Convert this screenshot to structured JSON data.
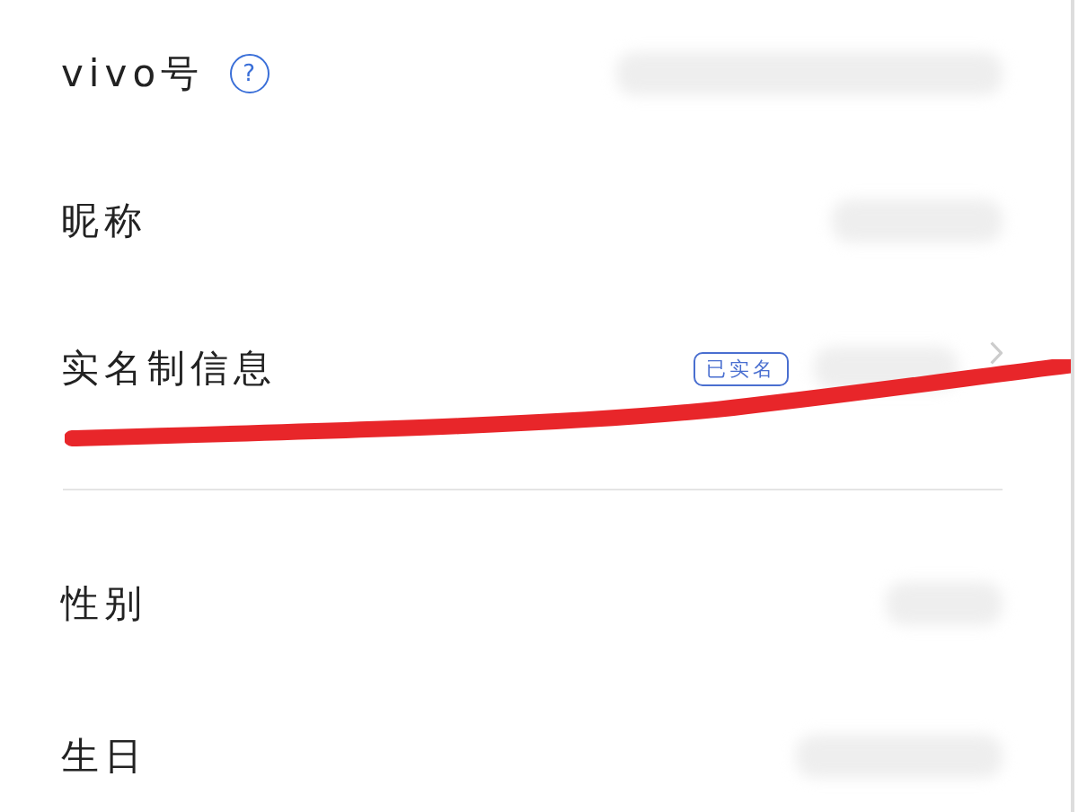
{
  "groups": [
    {
      "rows": [
        {
          "label": "vivo号",
          "help": "?",
          "value_hidden": true
        },
        {
          "label": "昵称",
          "value_hidden": true
        },
        {
          "label": "实名制信息",
          "badge": "已实名",
          "value_hidden": true,
          "chevron": true
        }
      ]
    },
    {
      "rows": [
        {
          "label": "性别",
          "value_hidden": true
        },
        {
          "label": "生日",
          "value_hidden": true
        }
      ]
    }
  ]
}
